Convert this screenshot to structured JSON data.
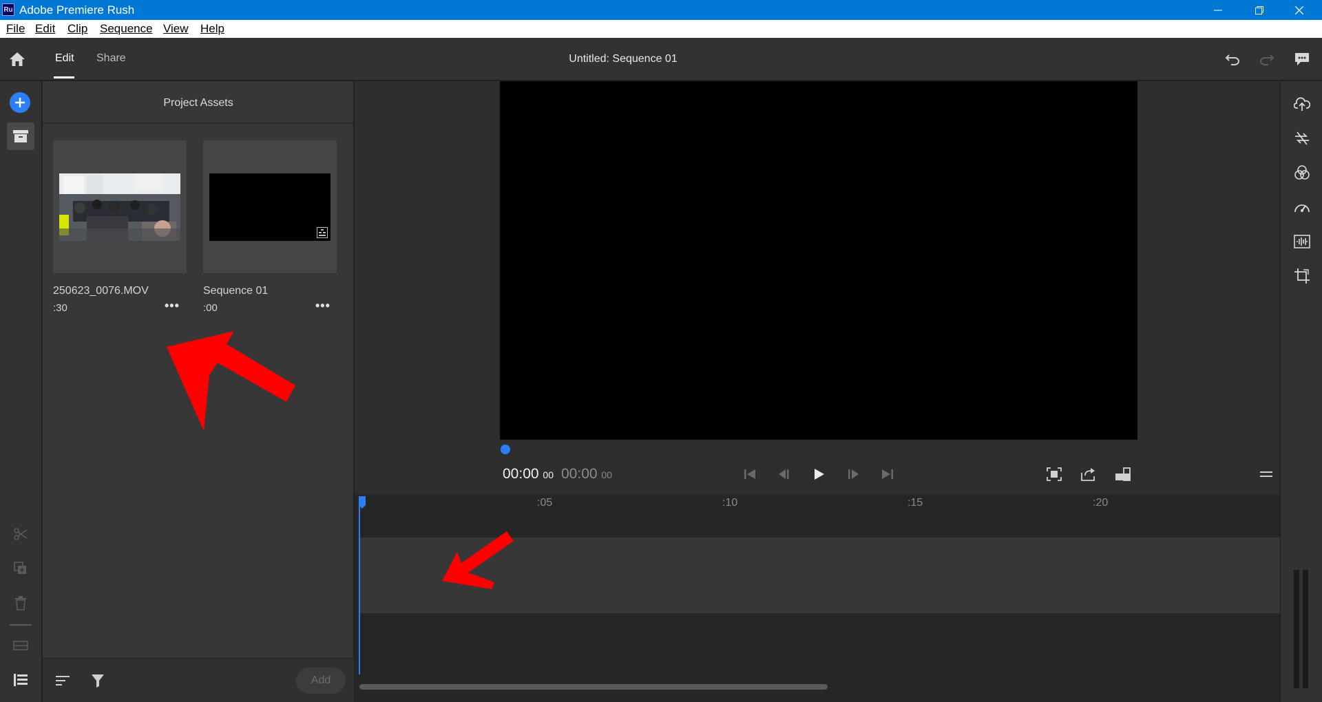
{
  "window": {
    "title": "Adobe Premiere Rush",
    "logo": "Ru"
  },
  "menu": {
    "items": [
      {
        "label": "File"
      },
      {
        "label": "Edit"
      },
      {
        "label": "Clip"
      },
      {
        "label": "Sequence"
      },
      {
        "label": "View"
      },
      {
        "label": "Help"
      }
    ]
  },
  "header": {
    "tabs": [
      {
        "label": "Edit",
        "active": true
      },
      {
        "label": "Share",
        "active": false
      }
    ],
    "sequence_title": "Untitled: Sequence 01"
  },
  "assets_panel": {
    "title": "Project Assets",
    "items": [
      {
        "name": "250623_0076.MOV",
        "duration": ":30"
      },
      {
        "name": "Sequence 01",
        "duration": ":00"
      }
    ],
    "add_label": "Add"
  },
  "player": {
    "current_time": "00:00",
    "current_frames": "00",
    "total_time": "00:00",
    "total_frames": "00"
  },
  "timeline": {
    "ruler": [
      ":05",
      ":10",
      ":15",
      ":20"
    ]
  },
  "colors": {
    "accent": "#2d7ff9",
    "titlebar": "#0078d4",
    "annotation_arrow": "#ff0000"
  }
}
